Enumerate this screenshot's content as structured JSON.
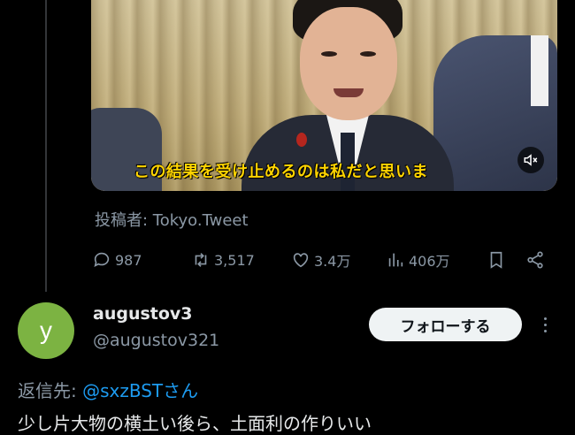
{
  "video": {
    "caption": "この結果を受け止めるのは私だと思いま",
    "mute_icon": "speaker-muted-icon"
  },
  "tweet": {
    "author_line": "投稿者: Tokyo.Tweet",
    "stats": {
      "replies": "987",
      "retweets": "3,517",
      "likes": "3.4万",
      "views": "406万"
    }
  },
  "reply": {
    "avatar_letter": "y",
    "avatar_color": "#7cb342",
    "display_name": "augustov3",
    "handle": "@augustov321",
    "follow_label": "フォローする",
    "reply_to_label": "返信先: ",
    "reply_to_mention": "@sxzBSTさん",
    "text": "少し片大物の横土い後ら、土面利の作りいい"
  }
}
